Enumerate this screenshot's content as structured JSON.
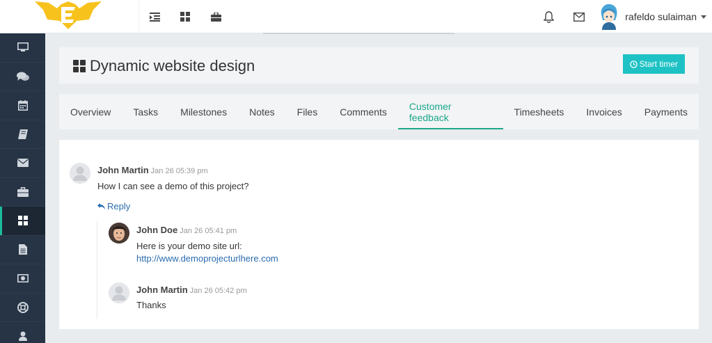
{
  "header": {
    "user_name": "rafeldo sulaiman"
  },
  "sidebar": {
    "items": [
      {
        "icon": "desktop-icon"
      },
      {
        "icon": "chat-icon"
      },
      {
        "icon": "calendar-icon"
      },
      {
        "icon": "book-icon"
      },
      {
        "icon": "envelope-icon"
      },
      {
        "icon": "briefcase-icon"
      },
      {
        "icon": "dashboard-icon"
      },
      {
        "icon": "file-icon"
      },
      {
        "icon": "money-icon"
      },
      {
        "icon": "support-icon"
      },
      {
        "icon": "user-icon"
      }
    ]
  },
  "project": {
    "title": "Dynamic website design",
    "timer_label": "Start timer"
  },
  "tabs": [
    "Overview",
    "Tasks",
    "Milestones",
    "Notes",
    "Files",
    "Comments",
    "Customer feedback",
    "Timesheets",
    "Invoices",
    "Payments"
  ],
  "feedback": {
    "main": {
      "author": "John Martin",
      "time": "Jan 26 05:39 pm",
      "text": "How I can see a demo of this project?",
      "reply_label": "Reply"
    },
    "replies": [
      {
        "author": "John Doe",
        "time": "Jan 26 05:41 pm",
        "text": "Here is your demo site url:",
        "link": "http://www.demoprojecturlhere.com"
      },
      {
        "author": "John Martin",
        "time": "Jan 26 05:42 pm",
        "text": "Thanks"
      }
    ]
  },
  "colors": {
    "accent": "#1aa889",
    "button": "#1fc2c4",
    "sidebar": "#263445",
    "link": "#2a6cb0"
  }
}
